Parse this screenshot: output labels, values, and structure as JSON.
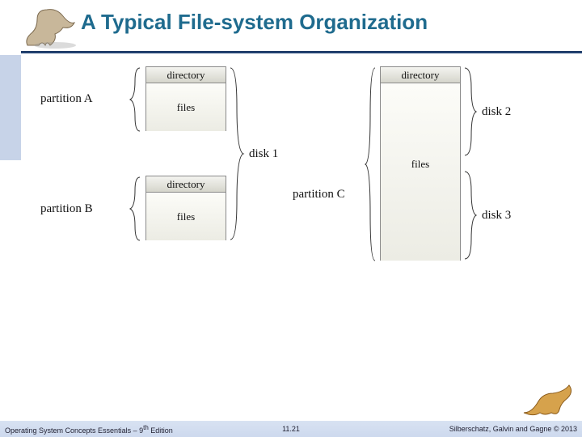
{
  "title": "A Typical File-system Organization",
  "footer": {
    "book": "Operating System Concepts Essentials – 9",
    "edition_suffix": "th",
    "edition_tail": " Edition",
    "page": "11.21",
    "copyright": "Silberschatz, Galvin and Gagne © 2013"
  },
  "diagram": {
    "labels": {
      "partitionA": "partition A",
      "partitionB": "partition B",
      "partitionC": "partition C",
      "disk1": "disk 1",
      "disk2": "disk 2",
      "disk3": "disk 3",
      "directory": "directory",
      "files": "files"
    }
  },
  "icons": {
    "dino_left": "dinosaur-icon",
    "dino_right": "dinosaur-icon"
  }
}
